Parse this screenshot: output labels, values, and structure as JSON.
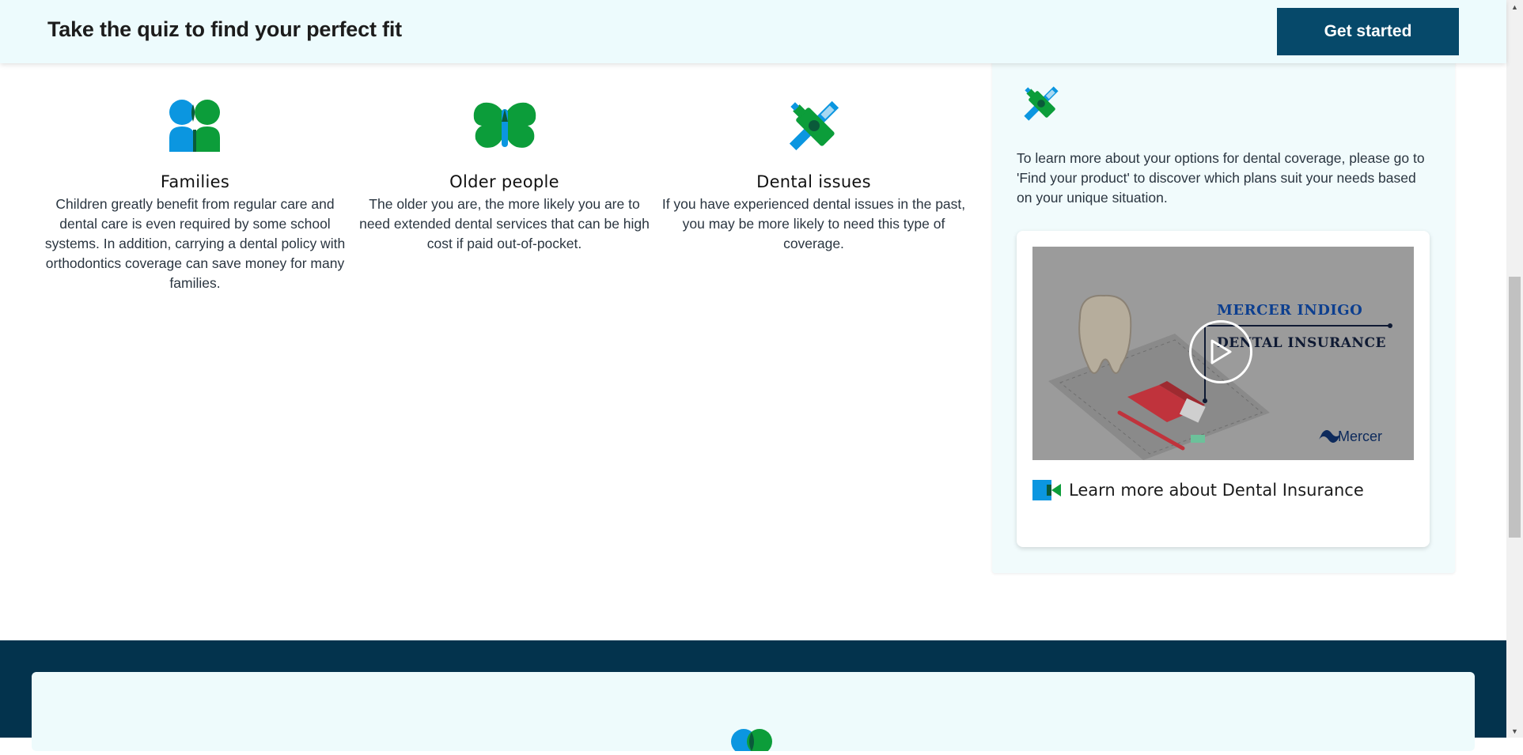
{
  "quiz_banner": {
    "title": "Take the quiz to find your perfect fit",
    "button_label": "Get started"
  },
  "audiences": [
    {
      "icon": "two-people-icon",
      "title": "Families",
      "description": "Children greatly benefit from regular care and dental care is even required by some school systems. In addition, carrying a dental policy with orthodontics coverage can save money for many families."
    },
    {
      "icon": "butterfly-icon",
      "title": "Older people",
      "description": "The older you are, the more likely you are to need extended dental services that can be high cost if paid out-of-pocket."
    },
    {
      "icon": "toothbrush-toothpaste-icon",
      "title": "Dental issues",
      "description": "If you have experienced dental issues in the past, you may be more likely to need this type of coverage."
    }
  ],
  "sidebar": {
    "icon": "toothbrush-toothpaste-icon",
    "text": "To learn more about your options for dental coverage, please go to 'Find your product' to discover which plans suit your needs based on your unique situation.",
    "video": {
      "brand": "MERCER INDIGO",
      "product": "DENTAL INSURANCE",
      "company": "Mercer",
      "link_icon": "video-camera-icon",
      "link_label": "Learn more about Dental Insurance"
    }
  },
  "colors": {
    "banner_bg": "#edfbfd",
    "button_bg": "#06496a",
    "icon_blue": "#0b96e0",
    "icon_green": "#0c9d3a",
    "footer_bg": "#03334d",
    "sidebar_bg": "#f1fbfc"
  }
}
